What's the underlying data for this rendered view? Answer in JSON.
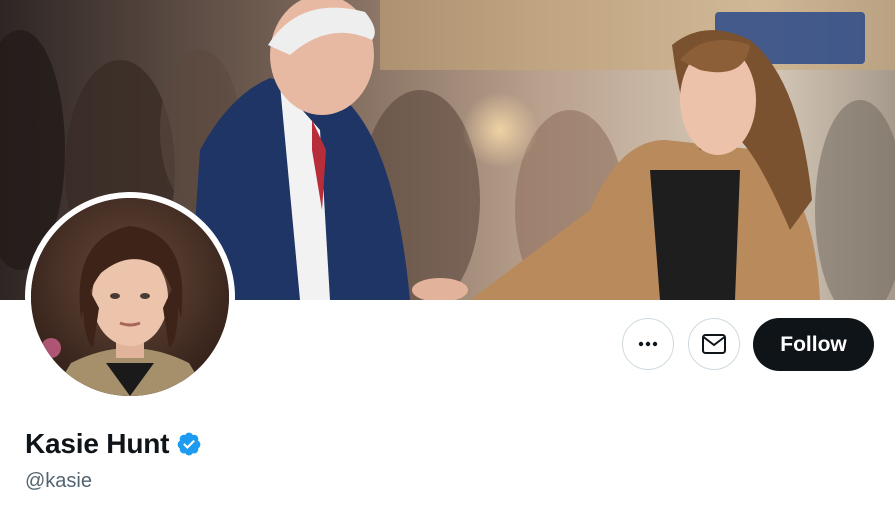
{
  "banner": {
    "image": "banner-photo",
    "description_icon": "photo"
  },
  "profile": {
    "display_name": "Kasie Hunt",
    "handle": "@kasie",
    "verified": true,
    "verified_badge_color": "#1d9bf0"
  },
  "actions": {
    "more_icon": "more-horizontal-icon",
    "message_icon": "envelope-icon",
    "follow_label": "Follow"
  },
  "colors": {
    "primary_text": "#0f1419",
    "secondary_text": "#536471",
    "border": "#cfd9de",
    "follow_bg": "#0f1419"
  }
}
